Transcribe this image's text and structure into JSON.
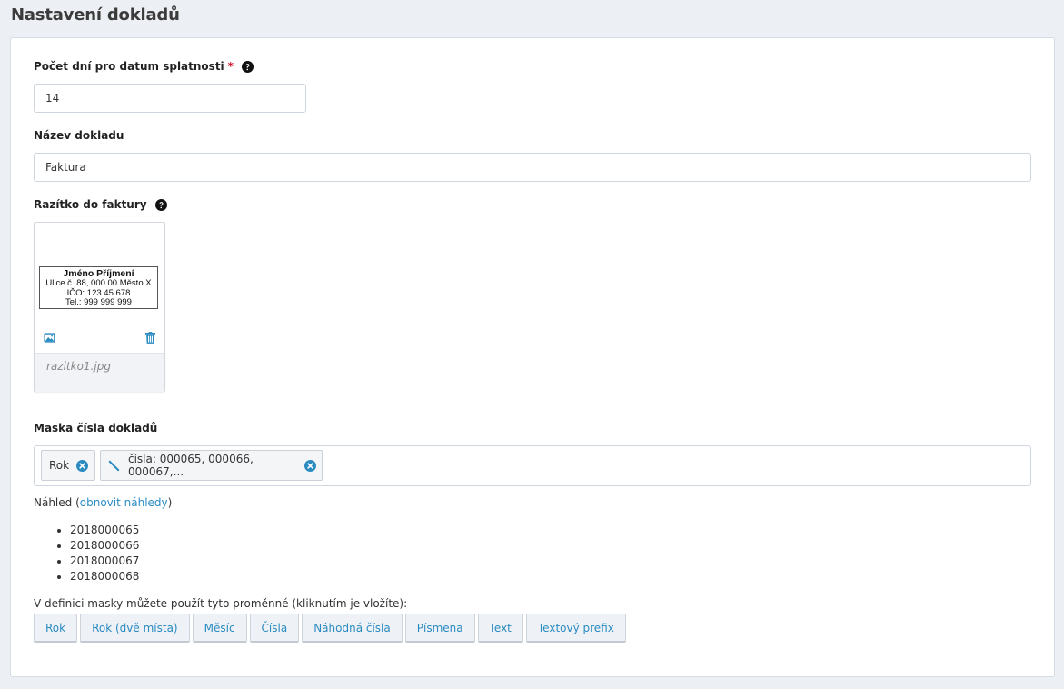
{
  "page_title": "Nastavení dokladů",
  "due_days": {
    "label": "Počet dní pro datum splatnosti",
    "required_mark": "*",
    "value": "14",
    "help_icon": "question-circle-icon"
  },
  "doc_name": {
    "label": "Název dokladu",
    "value": "Faktura"
  },
  "stamp": {
    "label": "Razítko do faktury",
    "help_icon": "question-circle-icon",
    "image_lines": [
      "Jméno Příjmení",
      "Ulice č. 88, 000 00  Město X",
      "IČO: 123 45 678",
      "Tel.: 999 999 999"
    ],
    "filename": "razitko1.jpg",
    "icons": [
      "image-icon",
      "trash-icon"
    ]
  },
  "mask": {
    "label": "Maska čísla dokladů",
    "chips": [
      {
        "label": "Rok",
        "icon": "remove-circle-icon"
      },
      {
        "label": "čísla: 000065, 000066, 000067,...",
        "icon": "remove-circle-icon",
        "edit_icon": "pencil-icon"
      }
    ]
  },
  "preview": {
    "prefix": "Náhled (",
    "link": "obnovit náhledy",
    "suffix": ")",
    "items": [
      "2018000065",
      "2018000066",
      "2018000067",
      "2018000068"
    ]
  },
  "variables": {
    "hint": "V definici masky můžete použít tyto proměnné (kliknutím je vložíte):",
    "buttons": [
      "Rok",
      "Rok (dvě místa)",
      "Měsíc",
      "Čísla",
      "Náhodná čísla",
      "Písmena",
      "Text",
      "Textový prefix"
    ]
  },
  "colors": {
    "accent": "#2a8bc2",
    "required": "#d0021b",
    "background": "#eceff3"
  }
}
